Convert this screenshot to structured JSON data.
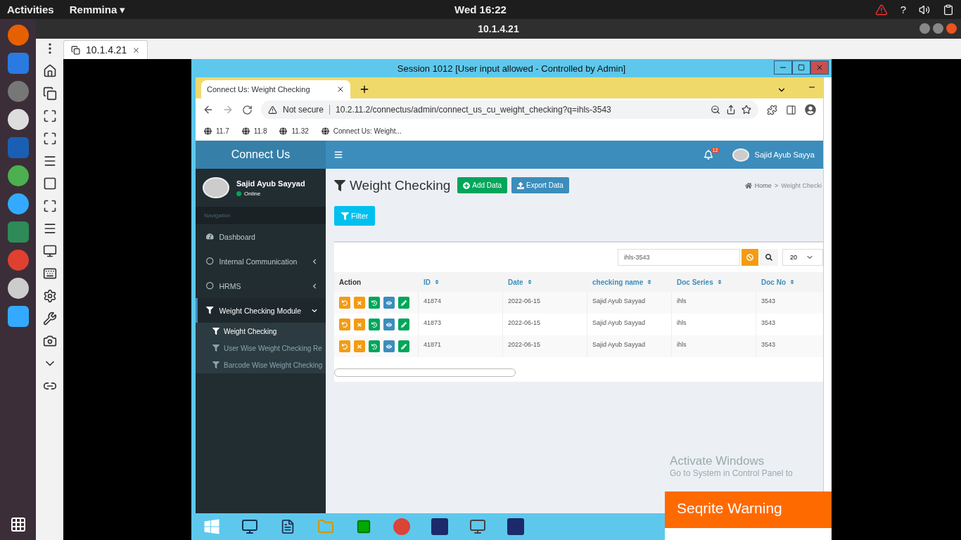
{
  "desktop_bar": {
    "activities": "Activities",
    "app_menu": "Remmina",
    "app_menu_caret": "▾",
    "clock": "Wed 16:22",
    "help": "?"
  },
  "remmina": {
    "window_title": "10.1.4.21",
    "tabs": [
      {
        "label": "10.1.4.21",
        "selected": true
      }
    ]
  },
  "remote_window": {
    "title": "Session 1012 [User input allowed - Controlled by Admin]"
  },
  "browser": {
    "tabs": [
      {
        "title": "Connect Us: Weight Checking",
        "selected": true
      }
    ],
    "security": "Not secure",
    "url": "10.2.11.2/connectus/admin/connect_us_cu_weight_checking?q=ihls-3543",
    "bookmarks": [
      "11.7",
      "11.8",
      "11.32",
      "Connect Us: Weight..."
    ]
  },
  "app": {
    "logo": "Connect Us",
    "notification_count": "12",
    "header_user": "Sajid Ayub Sayya",
    "sidebar": {
      "user": "Sajid Ayub Sayyad",
      "status": "Online",
      "section": "Navigation",
      "items": [
        {
          "label": "Dashboard",
          "kind": "gauge"
        },
        {
          "label": "Internal Communication",
          "kind": "circle",
          "expanded": false
        },
        {
          "label": "HRMS",
          "kind": "circle",
          "expanded": false
        },
        {
          "label": "Weight Checking Module",
          "kind": "filter",
          "expanded": true,
          "children": [
            {
              "label": "Weight Checking",
              "selected": true
            },
            {
              "label": "User Wise Weight Checking Re",
              "selected": false
            },
            {
              "label": "Barcode Wise Weight Checking",
              "selected": false
            }
          ]
        }
      ]
    },
    "page_title": "Weight Checking",
    "add_button": "Add Data",
    "export_button": "Export Data",
    "breadcrumb": [
      "Home",
      "Weight Checki"
    ],
    "breadcrumb_separator": ">",
    "filter_button": "Filter",
    "search": {
      "value": "ihls-3543"
    },
    "page_size": "20",
    "table": {
      "columns": [
        {
          "label": "Action",
          "sortable": false
        },
        {
          "label": "ID",
          "sortable": true
        },
        {
          "label": "Date",
          "sortable": true
        },
        {
          "label": "checking name",
          "sortable": true
        },
        {
          "label": "Doc Series",
          "sortable": true
        },
        {
          "label": "Doc No",
          "sortable": true
        }
      ],
      "rows": [
        [
          "",
          "41874",
          "2022-06-15",
          "Sajid Ayub Sayyad",
          "ihls",
          "3543"
        ],
        [
          "",
          "41873",
          "2022-06-15",
          "Sajid Ayub Sayyad",
          "ihls",
          "3543"
        ],
        [
          "",
          "41871",
          "2022-06-15",
          "Sajid Ayub Sayyad",
          "ihls",
          "3543"
        ]
      ]
    }
  },
  "activation_notice": {
    "title": "Activate Windows",
    "text": "Go to System in Control Panel to"
  },
  "security_popup": {
    "title": "Seqrite Warning"
  }
}
